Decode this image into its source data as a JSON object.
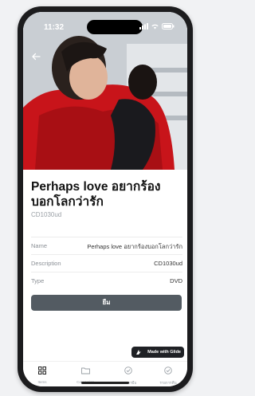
{
  "status_bar": {
    "time": "11:32"
  },
  "product": {
    "title": "Perhaps love อยากร้องบอกโลกว่ารัก",
    "code": "CD1030ud"
  },
  "details": [
    {
      "label": "Name",
      "value": "Perhaps love อยากร้องบอกโลกว่ารัก"
    },
    {
      "label": "Description",
      "value": "CD1030ud"
    },
    {
      "label": "Type",
      "value": "DVD"
    }
  ],
  "borrow_button": {
    "label": "ยืม"
  },
  "glide_badge": {
    "label": "Made with Glide"
  },
  "tabs": [
    {
      "label": "Items",
      "icon": "grid-icon"
    },
    {
      "label": "Categories",
      "icon": "folder-icon"
    },
    {
      "label": "รายการยืม",
      "icon": "check-circle-icon"
    },
    {
      "label": "รายการคืน",
      "icon": "check-circle-icon"
    }
  ],
  "colors": {
    "button": "#535b62",
    "coat": "#d11a1a"
  }
}
